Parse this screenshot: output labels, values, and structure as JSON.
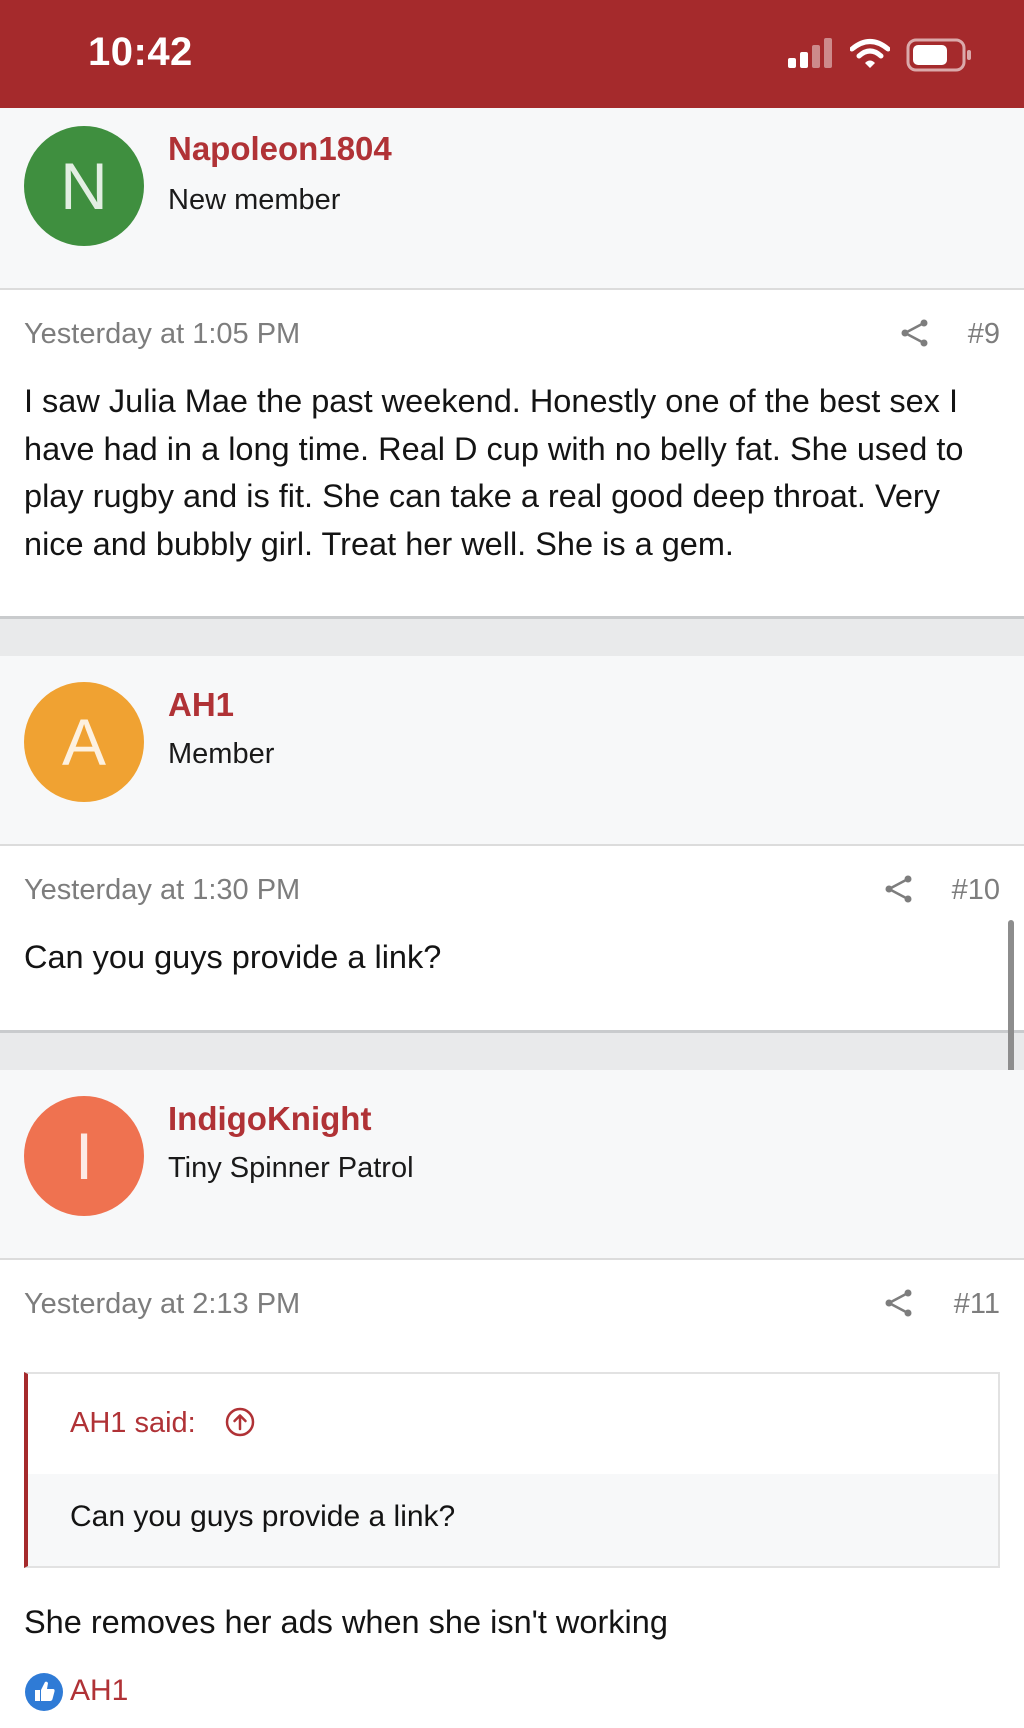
{
  "status_bar": {
    "time": "10:42",
    "icons": [
      "signal-icon",
      "wifi-icon",
      "battery-icon"
    ]
  },
  "colors": {
    "accent": "#a52a2c",
    "username": "#b03236"
  },
  "posts": [
    {
      "author": "Napoleon1804",
      "author_title": "New member",
      "avatar_letter": "N",
      "avatar_color": "#3f8f3f",
      "time": "Yesterday at 1:05 PM",
      "number": "#9",
      "body": "I saw Julia Mae the past weekend. Honestly one of the best sex I have had in a long time. Real D cup with no belly fat. She used to play rugby and is fit. She can take a real good deep throat. Very nice and bubbly girl. Treat her well. She is a gem."
    },
    {
      "author": "AH1",
      "author_title": "Member",
      "avatar_letter": "A",
      "avatar_color": "#f0a232",
      "time": "Yesterday at 1:30 PM",
      "number": "#10",
      "body": "Can you guys provide a link?"
    },
    {
      "author": "IndigoKnight",
      "author_title": "Tiny Spinner Patrol",
      "avatar_letter": "I",
      "avatar_color": "#ef7250",
      "time": "Yesterday at 2:13 PM",
      "number": "#11",
      "quote": {
        "author_label": "AH1 said:",
        "text": "Can you guys provide a link?"
      },
      "body": "She removes her ads when she isn't working",
      "likes": "AH1"
    }
  ]
}
